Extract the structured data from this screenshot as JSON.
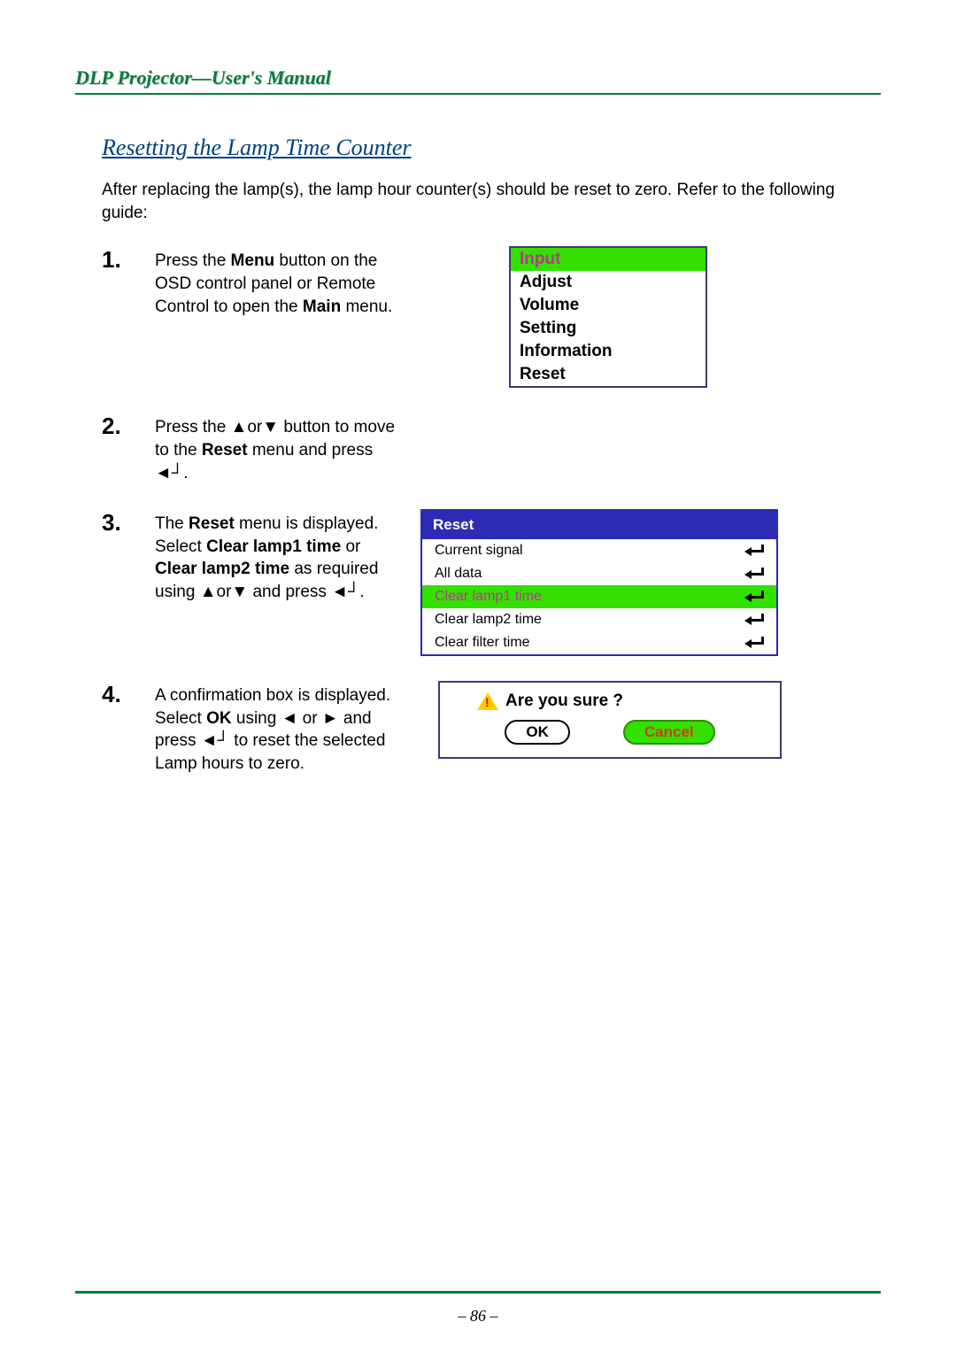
{
  "header": "DLP Projector—User's Manual",
  "section_title": "Resetting the Lamp Time Counter",
  "intro": "After replacing the lamp(s), the lamp hour counter(s) should be reset to zero. Refer to the following guide:",
  "steps": {
    "s1": {
      "num": "1.",
      "t1": "Press the ",
      "b1": "Menu",
      "t2": " button on the OSD control panel or Remote Control to open the ",
      "b2": "Main",
      "t3": " menu."
    },
    "s2": {
      "num": "2.",
      "t1": "Press the ▲or▼ button to move to the ",
      "b1": "Reset",
      "t2": " menu and press ◄┘."
    },
    "s3": {
      "num": "3.",
      "t1": "The ",
      "b1": "Reset",
      "t2": " menu is displayed. Select ",
      "b2": "Clear lamp1 time",
      "t3": " or ",
      "b3": "Clear lamp2 time",
      "t4": " as required using ▲or▼ and press ◄┘."
    },
    "s4": {
      "num": "4.",
      "t1": "A confirmation box is displayed. Select ",
      "b1": "OK",
      "t2": " using ◄ or ► and press ◄┘ to reset the selected Lamp hours to zero."
    }
  },
  "main_menu": {
    "items": [
      "Input",
      "Adjust",
      "Volume",
      "Setting",
      "Information",
      "Reset"
    ],
    "selected": 0
  },
  "reset_menu": {
    "header": "Reset",
    "items": [
      "Current signal",
      "All data",
      "Clear lamp1 time",
      "Clear lamp2 time",
      "Clear filter time"
    ],
    "selected": 2
  },
  "confirm": {
    "title": "Are you sure ?",
    "ok": "OK",
    "cancel": "Cancel",
    "selected": 1
  },
  "page_number": "– 86 –"
}
